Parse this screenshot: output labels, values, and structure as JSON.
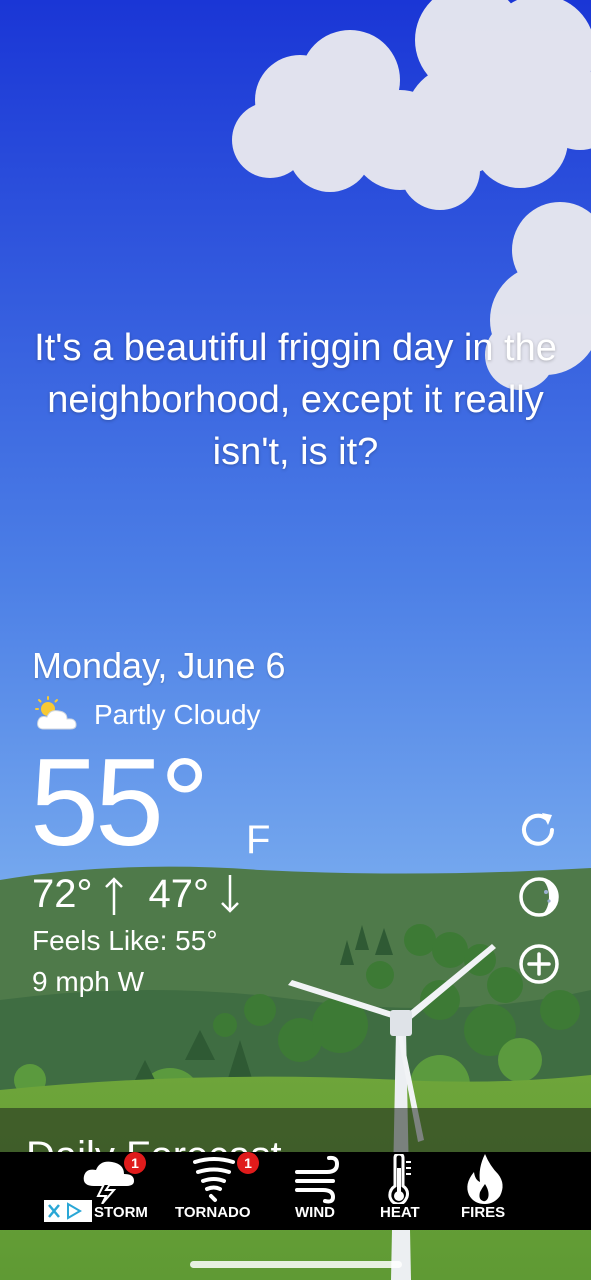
{
  "tagline": "It's a beautiful friggin day in the neighborhood, except it really isn't, is it?",
  "weather": {
    "date": "Monday, June 6",
    "condition": "Partly Cloudy",
    "condition_icon": "partly-cloudy-icon",
    "temperature": "55°",
    "unit": "F",
    "high": "72°",
    "low": "47°",
    "feels_like": "Feels Like: 55°",
    "wind": "9 mph W"
  },
  "side_buttons": [
    {
      "icon": "refresh-icon"
    },
    {
      "icon": "moon-phase-icon"
    },
    {
      "icon": "add-icon"
    }
  ],
  "forecast": {
    "title": "Daily Forecast"
  },
  "alert_tabs": [
    {
      "label": "STORM",
      "icon": "storm-icon",
      "badge": "1"
    },
    {
      "label": "TORNADO",
      "icon": "tornado-icon",
      "badge": "1"
    },
    {
      "label": "WIND",
      "icon": "wind-icon"
    },
    {
      "label": "HEAT",
      "icon": "thermometer-icon"
    },
    {
      "label": "FIRES",
      "icon": "fire-icon"
    }
  ],
  "colors": {
    "sky_top": "#1a36d6",
    "sky_bottom": "#7fb2f0",
    "hills": "#4f7a4a",
    "grass": "#6ea53a",
    "badge": "#e01b1b"
  }
}
